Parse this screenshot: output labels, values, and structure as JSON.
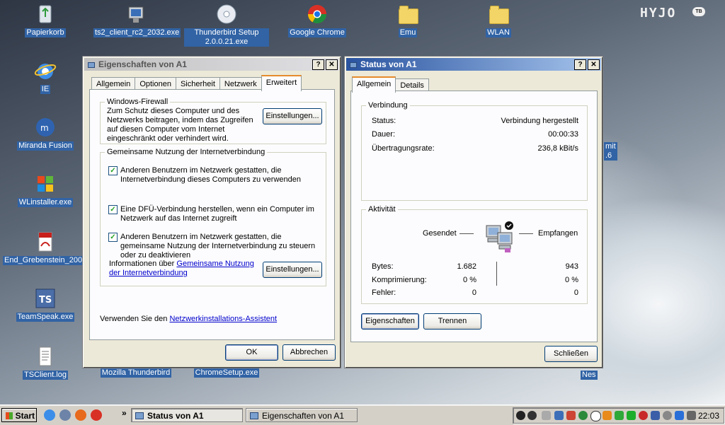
{
  "desktop": {
    "icons": [
      {
        "label": "Papierkorb"
      },
      {
        "label": "ts2_client_rc2_2032.exe"
      },
      {
        "label": "Thunderbird Setup 2.0.0.21.exe"
      },
      {
        "label": "Google Chrome"
      },
      {
        "label": "Emu"
      },
      {
        "label": "WLAN"
      },
      {
        "label": "IE"
      },
      {
        "label": "Miranda Fusion"
      },
      {
        "label": "WLinstaller.exe"
      },
      {
        "label": "End_Grebenstein_2009..."
      },
      {
        "label": "TeamSpeak.exe"
      },
      {
        "label": "TSClient.log"
      },
      {
        "label": "Mozilla Thunderbird"
      },
      {
        "label": "ChromeSetup.exe"
      },
      {
        "label": "mit"
      },
      {
        "label": ".6"
      },
      {
        "label": "Nes"
      }
    ],
    "logo_text": "HYJO",
    "logo_badge": "TB"
  },
  "props": {
    "title": "Eigenschaften von A1",
    "help_btn": "?",
    "close_btn": "✕",
    "tabs": [
      "Allgemein",
      "Optionen",
      "Sicherheit",
      "Netzwerk",
      "Erweitert"
    ],
    "firewall": {
      "title": "Windows-Firewall",
      "text": "Zum Schutz dieses Computer und des Netzwerks beitragen, indem das Zugreifen auf diesen Computer vom Internet eingeschränkt oder verhindert wird.",
      "button": "Einstellungen..."
    },
    "ics": {
      "title": "Gemeinsame Nutzung der Internetverbindung",
      "opt1": "Anderen Benutzern im Netzwerk gestatten, die Internetverbindung dieses Computers zu verwenden",
      "opt2": "Eine DFÜ-Verbindung herstellen, wenn ein Computer im Netzwerk auf das Internet zugreift",
      "opt3": "Anderen Benutzern im Netzwerk gestatten, die gemeinsame Nutzung der Internetverbindung zu steuern oder zu deaktivieren",
      "info_prefix": "Informationen über ",
      "info_link": "Gemeinsame Nutzung der Internetverbindung",
      "button": "Einstellungen...",
      "check": "✓"
    },
    "wizard_prefix": "Verwenden Sie den ",
    "wizard_link": "Netzwerkinstallations-Assistent",
    "ok": "OK",
    "cancel": "Abbrechen"
  },
  "status": {
    "title": "Status von A1",
    "help_btn": "?",
    "close_btn": "✕",
    "tabs": [
      "Allgemein",
      "Details"
    ],
    "verbindung": {
      "title": "Verbindung",
      "status_label": "Status:",
      "status_value": "Verbindung hergestellt",
      "dauer_label": "Dauer:",
      "dauer_value": "00:00:33",
      "rate_label": "Übertragungsrate:",
      "rate_value": "236,8 kBit/s"
    },
    "aktivitaet": {
      "title": "Aktivität",
      "sent_label": "Gesendet",
      "recv_label": "Empfangen",
      "bytes_label": "Bytes:",
      "bytes_sent": "1.682",
      "bytes_recv": "943",
      "comp_label": "Komprimierung:",
      "comp_sent": "0 %",
      "comp_recv": "0 %",
      "err_label": "Fehler:",
      "err_sent": "0",
      "err_recv": "0"
    },
    "props_btn": "Eigenschaften",
    "disconnect_btn": "Trennen",
    "close_label": "Schließen"
  },
  "taskbar": {
    "start": "Start",
    "chevron": "»",
    "tasks": [
      "Status von A1",
      "Eigenschaften von A1"
    ],
    "clock": "22:03"
  }
}
